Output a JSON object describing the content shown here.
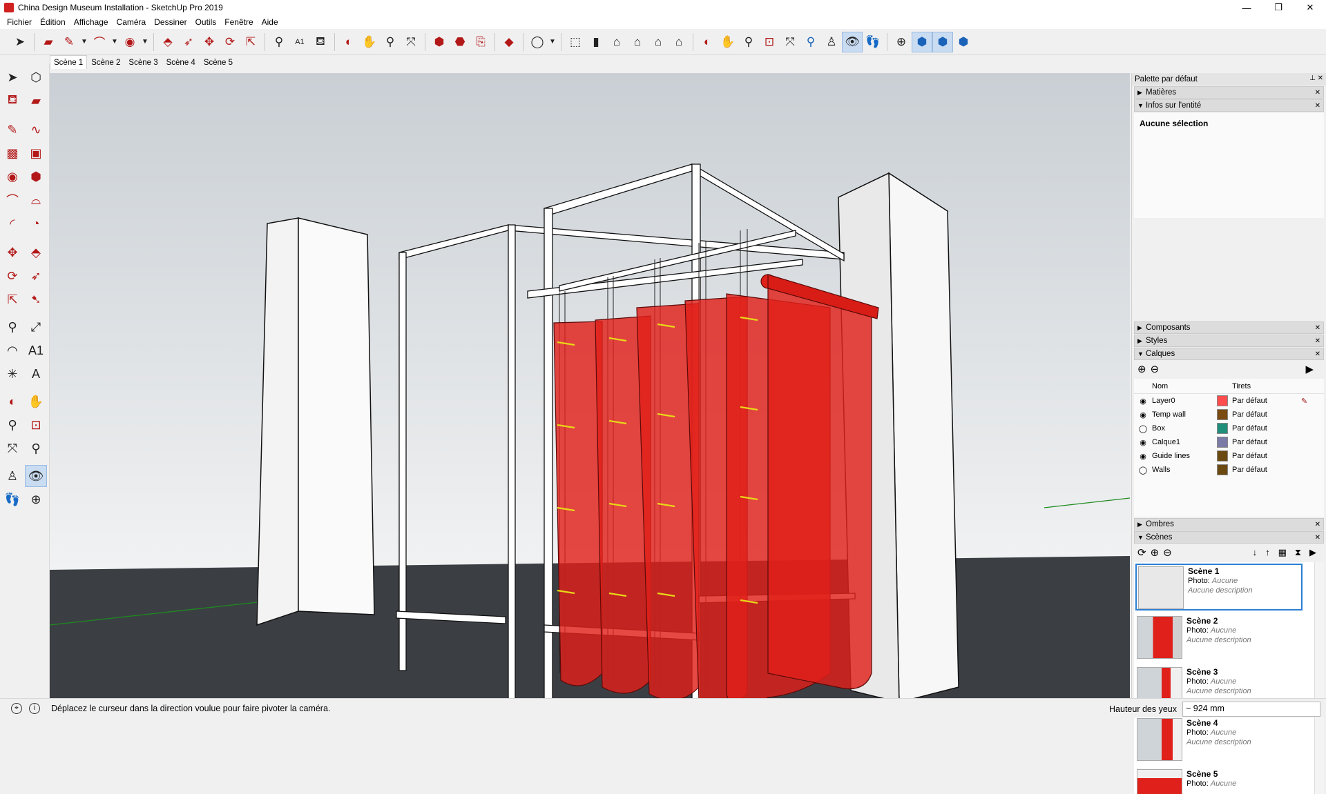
{
  "window": {
    "title": "China Design Museum Installation - SketchUp Pro 2019",
    "minimize": "—",
    "maximize": "❐",
    "close": "✕"
  },
  "menu": [
    "Fichier",
    "Édition",
    "Affichage",
    "Caméra",
    "Dessiner",
    "Outils",
    "Fenêtre",
    "Aide"
  ],
  "scene_tabs": [
    "Scène 1",
    "Scène 2",
    "Scène 3",
    "Scène 4",
    "Scène 5"
  ],
  "status": {
    "message": "Déplacez le curseur dans la direction voulue pour faire pivoter la caméra.",
    "measure_label": "Hauteur des yeux",
    "measure_value": "~ 924 mm"
  },
  "tray": {
    "title": "Palette par défaut",
    "panels": {
      "materials": "Matières",
      "entity_info": "Infos sur l'entité",
      "components": "Composants",
      "styles": "Styles",
      "layers": "Calques",
      "shadows": "Ombres",
      "scenes": "Scènes"
    },
    "entity_info_text": "Aucune sélection",
    "layer_columns": {
      "name": "Nom",
      "dashes": "Tirets"
    },
    "layers": [
      {
        "name": "Layer0",
        "color": "#ff4d4d",
        "dashes": "Par défaut",
        "visible": true
      },
      {
        "name": "Temp wall",
        "color": "#7a4a10",
        "dashes": "Par défaut",
        "visible": true
      },
      {
        "name": "Box",
        "color": "#1f8f7a",
        "dashes": "Par défaut",
        "visible": false
      },
      {
        "name": "Calque1",
        "color": "#7b7ba8",
        "dashes": "Par défaut",
        "visible": true
      },
      {
        "name": "Guide lines",
        "color": "#6b4a12",
        "dashes": "Par défaut",
        "visible": true
      },
      {
        "name": "Walls",
        "color": "#6b4a12",
        "dashes": "Par défaut",
        "visible": false
      }
    ],
    "scenes": [
      {
        "name": "Scène 1",
        "photo_label": "Photo:",
        "photo": "Aucune",
        "description": "Aucune description"
      },
      {
        "name": "Scène 2",
        "photo_label": "Photo:",
        "photo": "Aucune",
        "description": "Aucune description"
      },
      {
        "name": "Scène 3",
        "photo_label": "Photo:",
        "photo": "Aucune",
        "description": "Aucune description"
      },
      {
        "name": "Scène 4",
        "photo_label": "Photo:",
        "photo": "Aucune",
        "description": "Aucune description"
      },
      {
        "name": "Scène 5",
        "photo_label": "Photo:",
        "photo": "Aucune",
        "description": ""
      }
    ]
  },
  "colors": {
    "accent": "#2b7fd4",
    "fabric": "#e0201a",
    "ground": "#3b3f44",
    "sky": "#dfe3e6"
  }
}
